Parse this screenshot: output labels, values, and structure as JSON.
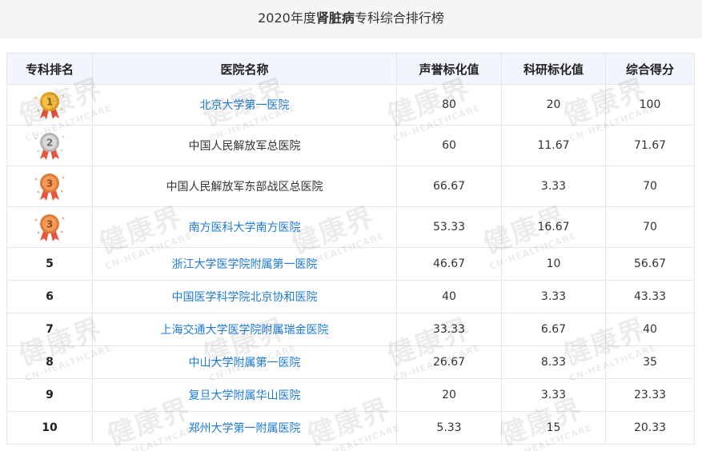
{
  "title": {
    "prefix": "2020年度",
    "emphasis": "肾脏病",
    "suffix": "专科综合排行榜"
  },
  "columns": [
    "专科排名",
    "医院名称",
    "声誉标化值",
    "科研标化值",
    "综合得分"
  ],
  "rows": [
    {
      "rank": "1",
      "medal": "gold",
      "hospital": "北京大学第一医院",
      "link": true,
      "reputation": "80",
      "research": "20",
      "score": "100"
    },
    {
      "rank": "2",
      "medal": "silver",
      "hospital": "中国人民解放军总医院",
      "link": false,
      "reputation": "60",
      "research": "11.67",
      "score": "71.67"
    },
    {
      "rank": "3",
      "medal": "bronze",
      "hospital": "中国人民解放军东部战区总医院",
      "link": false,
      "reputation": "66.67",
      "research": "3.33",
      "score": "70"
    },
    {
      "rank": "3",
      "medal": "bronze",
      "hospital": "南方医科大学南方医院",
      "link": true,
      "reputation": "53.33",
      "research": "16.67",
      "score": "70"
    },
    {
      "rank": "5",
      "medal": null,
      "hospital": "浙江大学医学院附属第一医院",
      "link": true,
      "reputation": "46.67",
      "research": "10",
      "score": "56.67"
    },
    {
      "rank": "6",
      "medal": null,
      "hospital": "中国医学科学院北京协和医院",
      "link": true,
      "reputation": "40",
      "research": "3.33",
      "score": "43.33"
    },
    {
      "rank": "7",
      "medal": null,
      "hospital": "上海交通大学医学院附属瑞金医院",
      "link": true,
      "reputation": "33.33",
      "research": "6.67",
      "score": "40"
    },
    {
      "rank": "8",
      "medal": null,
      "hospital": "中山大学附属第一医院",
      "link": true,
      "reputation": "26.67",
      "research": "8.33",
      "score": "35"
    },
    {
      "rank": "9",
      "medal": null,
      "hospital": "复旦大学附属华山医院",
      "link": true,
      "reputation": "20",
      "research": "3.33",
      "score": "23.33"
    },
    {
      "rank": "10",
      "medal": null,
      "hospital": "郑州大学第一附属医院",
      "link": true,
      "reputation": "5.33",
      "research": "15",
      "score": "20.33"
    }
  ],
  "medal_colors": {
    "gold": {
      "face": "#f6c14b",
      "rim": "#e3a21f",
      "ribbon": "#e8553e",
      "text": "#9a6a05"
    },
    "silver": {
      "face": "#d9d9d9",
      "rim": "#b5b5b5",
      "ribbon": "#e8553e",
      "text": "#6d6d6d"
    },
    "bronze": {
      "face": "#f29a5c",
      "rim": "#e07a3a",
      "ribbon": "#e8553e",
      "text": "#9c4a18"
    }
  },
  "link_color": "#1f7bd6",
  "watermark": {
    "cn": "健康界",
    "en": "CN-HEALTHCARE"
  }
}
